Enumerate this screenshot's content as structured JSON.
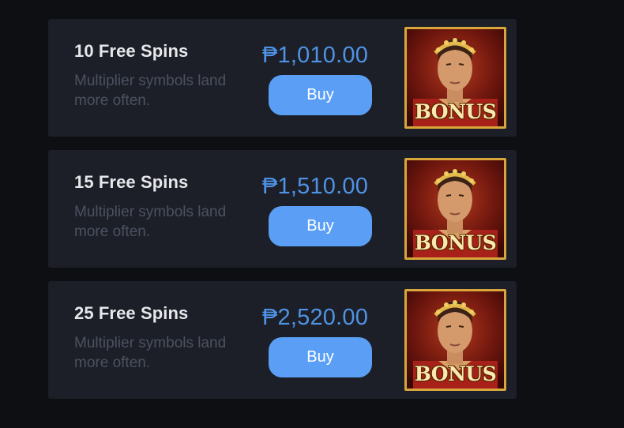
{
  "offers": [
    {
      "title": "10 Free Spins",
      "description": "Multiplier symbols land more often.",
      "price": "₱1,010.00",
      "buy_label": "Buy",
      "image_label": "BONUS",
      "image_icon": "gladiator-portrait-icon"
    },
    {
      "title": "15 Free Spins",
      "description": "Multiplier symbols land more often.",
      "price": "₱1,510.00",
      "buy_label": "Buy",
      "image_label": "BONUS",
      "image_icon": "gladiator-portrait-icon"
    },
    {
      "title": "25 Free Spins",
      "description": "Multiplier symbols land more often.",
      "price": "₱2,520.00",
      "buy_label": "Buy",
      "image_label": "BONUS",
      "image_icon": "gladiator-portrait-icon"
    }
  ],
  "colors": {
    "background": "#0e0f13",
    "card": "#1c1f27",
    "price": "#4f93e6",
    "button": "#5a9ff5",
    "frame": "#d9a63c"
  }
}
